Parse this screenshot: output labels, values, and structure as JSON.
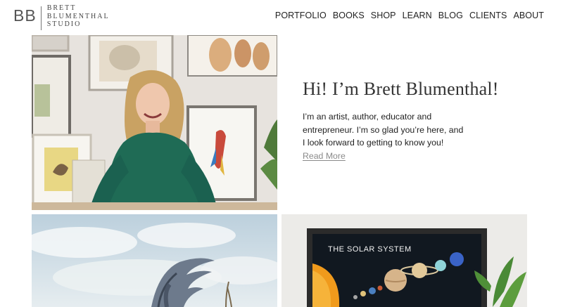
{
  "logo": {
    "mark": "BB",
    "line1": "BRETT",
    "line2": "BLUMENTHAL",
    "line3": "STUDIO"
  },
  "nav": {
    "items": [
      "PORTFOLIO",
      "BOOKS",
      "SHOP",
      "LEARN",
      "BLOG",
      "CLIENTS",
      "ABOUT"
    ]
  },
  "intro": {
    "title": "Hi! I’m Brett Blumenthal!",
    "body": "I’m an artist, author, educator and entrepreneur. I’m so glad you’re here, and I look forward to getting to know you!",
    "read_more": "Read More"
  },
  "tiles": {
    "solar_title": "THE SOLAR SYSTEM"
  },
  "colors": {
    "text": "#222222",
    "link_muted": "#8a8a8a",
    "background": "#ffffff",
    "sweater": "#1f6b55"
  }
}
